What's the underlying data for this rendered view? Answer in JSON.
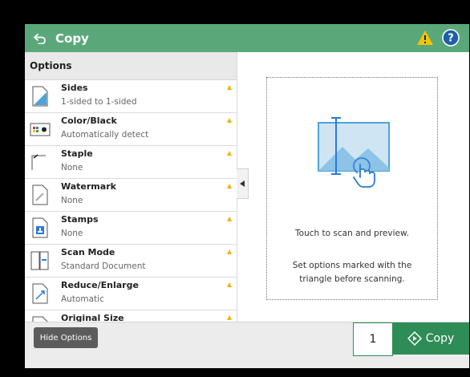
{
  "header": {
    "title": "Copy",
    "back_icon": "back-arrow-icon",
    "warning_icon": "warning-icon",
    "help_icon": "help-icon",
    "colors": {
      "bar": "#5aa87a",
      "warning": "#f5c400",
      "help": "#1f5faa"
    }
  },
  "options_panel": {
    "header": "Options",
    "items": [
      {
        "label": "Sides",
        "value": "1-sided to 1-sided",
        "icon": "sides-icon"
      },
      {
        "label": "Color/Black",
        "value": "Automatically detect",
        "icon": "color-icon"
      },
      {
        "label": "Staple",
        "value": "None",
        "icon": "staple-icon"
      },
      {
        "label": "Watermark",
        "value": "None",
        "icon": "watermark-icon"
      },
      {
        "label": "Stamps",
        "value": "None",
        "icon": "stamps-icon"
      },
      {
        "label": "Scan Mode",
        "value": "Standard Document",
        "icon": "scan-mode-icon"
      },
      {
        "label": "Reduce/Enlarge",
        "value": "Automatic",
        "icon": "reduce-enlarge-icon"
      },
      {
        "label": "Original Size",
        "value": "",
        "icon": "original-size-icon"
      }
    ]
  },
  "preview": {
    "line1": "Touch to scan and preview.",
    "line2": "Set options marked with the triangle before scanning."
  },
  "footer": {
    "hide_options_label": "Hide Options",
    "copies": "1",
    "copy_label": "Copy",
    "accent": "#2e8c57"
  }
}
